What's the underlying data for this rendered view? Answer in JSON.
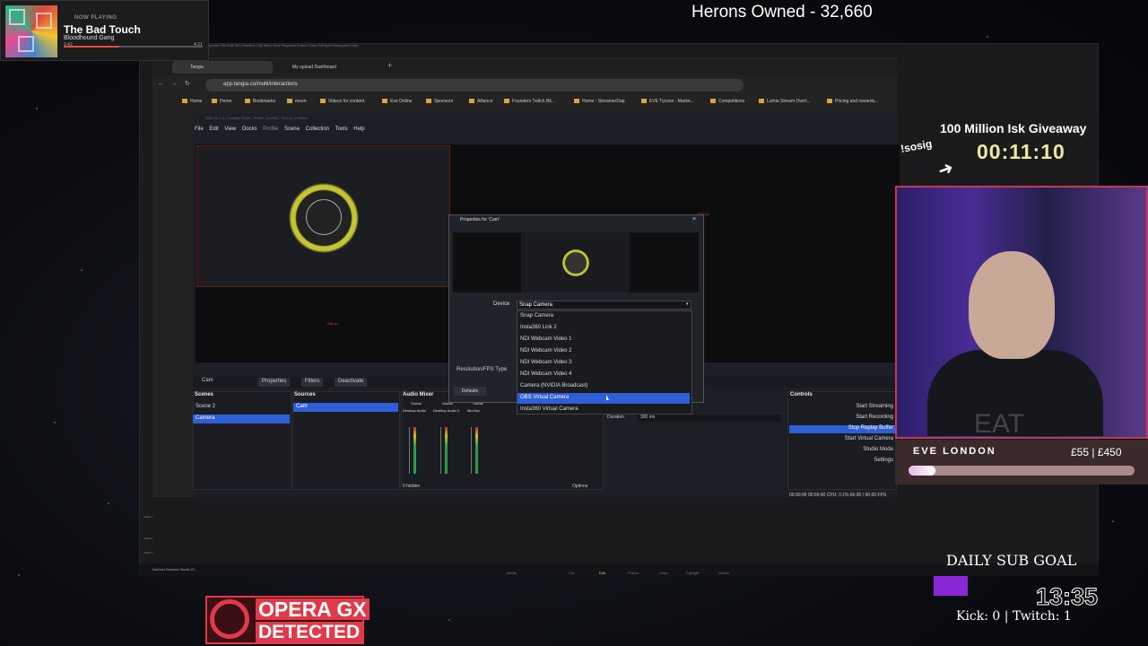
{
  "now_playing": {
    "label": "NOW PLAYING",
    "title": "The Bad Touch",
    "artist": "Bloodhound Gang",
    "elapsed": "1:42",
    "total": "4:21",
    "progress": 0.4
  },
  "overlay": {
    "herons": "Herons Owned - 32,660",
    "giveaway": "100 Million Isk Giveaway",
    "timer": "00:11:10",
    "sosig": "!sosig",
    "eve_name": "EVE LONDON",
    "eve_amount": "£55 | £450",
    "eve_progress": 0.12,
    "sub_goal": "DAILY SUB GOAL",
    "clock": "13:35",
    "kick": "Kick: 0 | Twitch: 1",
    "opera_line1": "OPERA GX",
    "opera_line2": "DETECTED",
    "accent": "#e03a4a",
    "cam_border": "#c23a58",
    "shirt": "EAT"
  },
  "resolve": {
    "menu": "DaVinci Resolve   File   Edit   Trim   Timeline   Clip   Mark   View   Playback   Fusion   Color   Fairlight   Workspace   Help",
    "brand": "DaVinci Resolve Studio 21",
    "tabs": [
      "Media",
      "Cut",
      "Edit",
      "Fusion",
      "Color",
      "Fairlight",
      "Deliver"
    ],
    "tracks": [
      "Audio 1",
      "Audio 2",
      "Audio 3"
    ]
  },
  "browser": {
    "tabs": [
      "Tangia",
      "My upload Dashboard"
    ],
    "url": "app.tangia.co/multi/interactions",
    "bookmarks": [
      "Home",
      "Bookmarks",
      "moon",
      "Videos for content",
      "Eve Online",
      "Sponsors",
      "Alliance",
      "Founders Twitch Bit...",
      "Home - StreamerDap",
      "EVE Tycoon - Marke...",
      "Competitions",
      "Lumia Stream Overl...",
      "Pricing and rewards..."
    ]
  },
  "obs": {
    "title": "OBS 32.1.2 - Portable Mode - Profile: Untitled - Scenes: Untitled",
    "menu": [
      "File",
      "Edit",
      "View",
      "Docks",
      "Profile",
      "Scene Collection",
      "Tools",
      "Help"
    ],
    "px_label": "266 px",
    "px_label2": "1080 px",
    "source_selected": "Cam",
    "btn_properties": "Properties",
    "btn_filters": "Filters",
    "btn_deactivate": "Deactivate",
    "docks": {
      "scenes": "Scenes",
      "sources": "Sources",
      "mixer": "Audio Mixer",
      "controls": "Controls"
    },
    "scenes": [
      "Scene 2",
      "Camera"
    ],
    "sources": [
      "Cam"
    ],
    "mixer_channels": [
      "Desktop Audio",
      "Desktop Audio 2",
      "Mic/Aux"
    ],
    "mixer_header": "Global",
    "hidden": "0 hidden",
    "options": "Options",
    "duration_label": "Duration",
    "duration_value": "300 ms",
    "controls": [
      "Start Streaming",
      "Start Recording",
      "Stop Replay Buffer",
      "Start Virtual Camera",
      "Studio Mode",
      "Settings"
    ],
    "status": "00:00:00   00:00:00   CPU: 3.1%   60.00 / 60.00 FPS"
  },
  "dialog": {
    "title": "Properties for 'Cam'",
    "device_label": "Device",
    "device_value": "Snap Camera",
    "res_label": "Resolution/FPS Type",
    "defaults": "Defaults",
    "options": [
      "Snap Camera",
      "Insta360 Link 2",
      "NDI Webcam Video 1",
      "NDI Webcam Video 2",
      "NDI Webcam Video 3",
      "NDI Webcam Video 4",
      "Camera (NVIDIA Broadcast)",
      "OBS Virtual Camera",
      "Insta360 Virtual Camera"
    ],
    "selected_index": 7
  }
}
